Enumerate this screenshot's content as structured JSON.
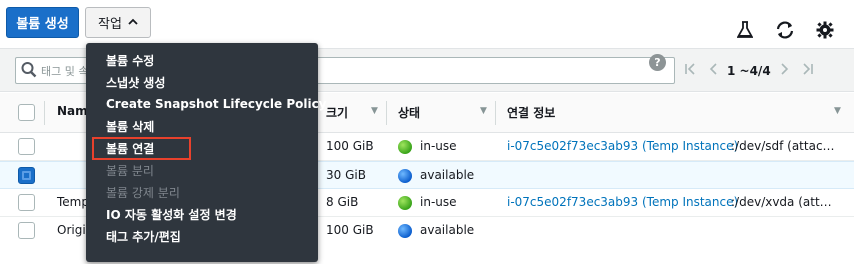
{
  "toolbar": {
    "create_volume_label": "볼륨 생성",
    "actions_label": "작업",
    "icons": [
      "flask-icon",
      "refresh-icon",
      "gear-icon"
    ]
  },
  "search": {
    "placeholder": "태그 및 속성별 필터 또는 키워드별 검색",
    "help_symbol": "?"
  },
  "pagination": {
    "text": "1 ~4/4"
  },
  "table": {
    "headers": {
      "name": "Nam",
      "size": "크기",
      "state": "상태",
      "attachment": "연결 정보"
    },
    "rows": [
      {
        "name": "",
        "size": "100 GiB",
        "state": "in-use",
        "state_color": "green",
        "attachment_link": "i-07c5e02f73ec3ab93 (Temp Instance)",
        "attachment_rest": ":/dev/sdf (attac…",
        "selected": false
      },
      {
        "name": "",
        "size": "30 GiB",
        "state": "available",
        "state_color": "blue",
        "attachment_link": "",
        "attachment_rest": "",
        "selected": true
      },
      {
        "name": "Temp",
        "size": "8 GiB",
        "state": "in-use",
        "state_color": "green",
        "attachment_link": "i-07c5e02f73ec3ab93 (Temp Instance)",
        "attachment_rest": ":/dev/xvda (att…",
        "selected": false
      },
      {
        "name": "Origi",
        "size": "100 GiB",
        "state": "available",
        "state_color": "blue",
        "attachment_link": "",
        "attachment_rest": "",
        "selected": false
      }
    ]
  },
  "menu": {
    "items": [
      {
        "label": "볼륨 수정",
        "disabled": false
      },
      {
        "label": "스냅샷 생성",
        "disabled": false
      },
      {
        "label": "Create Snapshot Lifecycle Policy",
        "disabled": false
      },
      {
        "label": "볼륨 삭제",
        "disabled": false
      },
      {
        "label": "볼륨 연결",
        "disabled": false,
        "highlighted": true
      },
      {
        "label": "볼륨 분리",
        "disabled": true
      },
      {
        "label": "볼륨 강제 분리",
        "disabled": true
      },
      {
        "label": "IO 자동 활성화 설정 변경",
        "disabled": false
      },
      {
        "label": "태그 추가/편집",
        "disabled": false
      }
    ]
  },
  "colors": {
    "primary": "#1a6fc9",
    "menu_bg": "#2f363e",
    "highlight_outline": "#e8412c",
    "link": "#0073bb",
    "in_use": "#3aa41b",
    "available": "#0d5fce"
  }
}
